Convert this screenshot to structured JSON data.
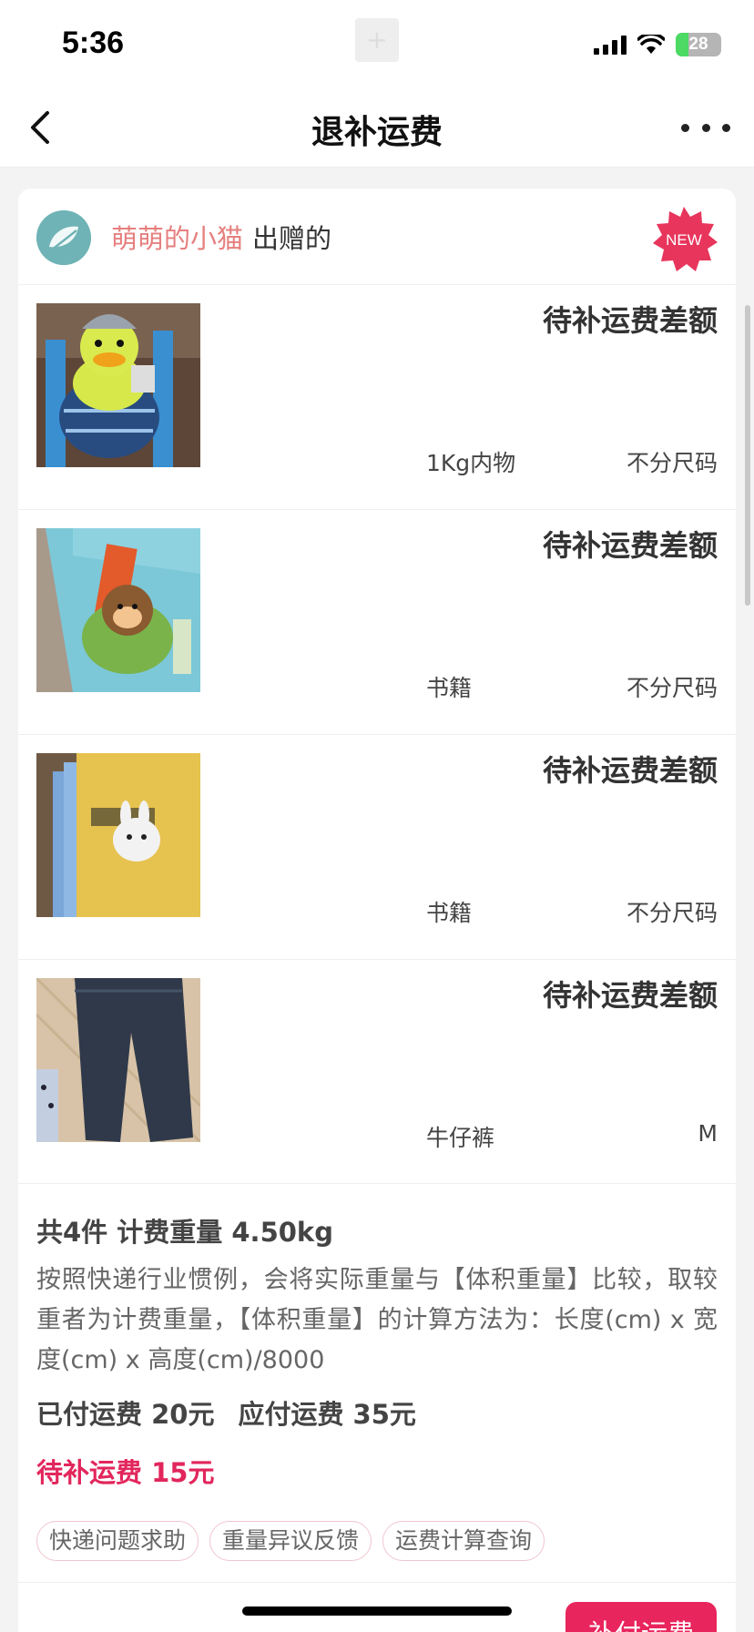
{
  "status_bar": {
    "time": "5:36",
    "center_glyph": "+",
    "battery": "28",
    "battery_level": 0.28
  },
  "nav": {
    "title": "退补运费",
    "back_icon": "chevron-left-icon",
    "more_icon": "more-dots-icon"
  },
  "card": {
    "giver_name": "萌萌的小猫",
    "giver_suffix": "出赠的",
    "new_badge": "NEW",
    "items": [
      {
        "title": "待补运费差额",
        "category": "1Kg内物",
        "size": "不分尺码",
        "image": "duck-backpack"
      },
      {
        "title": "待补运费差额",
        "category": "书籍",
        "size": "不分尺码",
        "image": "monkey-book"
      },
      {
        "title": "待补运费差额",
        "category": "书籍",
        "size": "不分尺码",
        "image": "rabbit-books"
      },
      {
        "title": "待补运费差额",
        "category": "牛仔裤",
        "size": "M",
        "image": "jeans"
      }
    ]
  },
  "summary": {
    "line1": "共4件 计费重量 4.50kg",
    "note": "按照快递行业惯例，会将实际重量与【体积重量】比较，取较重者为计费重量，【体积重量】的计算方法为：长度(cm) x 宽度(cm) x 高度(cm)/8000",
    "paid": "已付运费 20元",
    "payable": "应付运费 35元",
    "due": "待补运费 15元",
    "chips": [
      "快递问题求助",
      "重量异议反馈",
      "运费计算查询"
    ]
  },
  "pay_button": "补付运费",
  "colors": {
    "accent": "#e8255c",
    "giver": "#e5807f"
  }
}
